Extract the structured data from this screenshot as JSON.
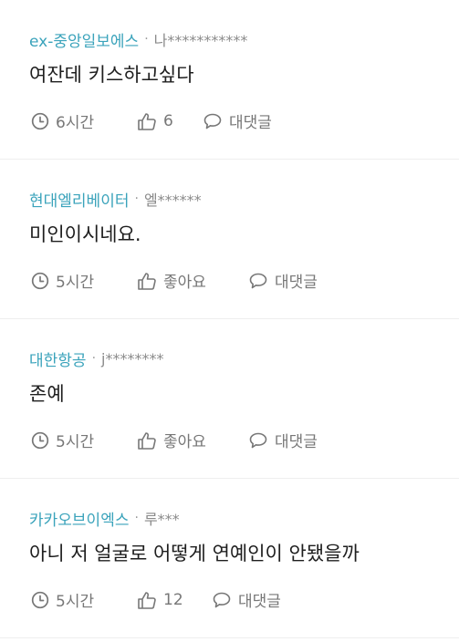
{
  "comments": [
    {
      "company": "ex-중앙일보에스",
      "separator": "·",
      "author": "나***********",
      "text": "여잔데 키스하고싶다",
      "time": "6시간",
      "likes": "6",
      "reply_label": "대댓글"
    },
    {
      "company": "현대엘리베이터",
      "separator": "·",
      "author": "엘******",
      "text": "미인이시네요.",
      "time": "5시간",
      "likes": "좋아요",
      "reply_label": "대댓글"
    },
    {
      "company": "대한항공",
      "separator": "·",
      "author": "j********",
      "text": "존예",
      "time": "5시간",
      "likes": "좋아요",
      "reply_label": "대댓글"
    },
    {
      "company": "카카오브이엑스",
      "separator": "·",
      "author": "루***",
      "text": "아니 저 얼굴로 어떻게 연예인이 안됐을까",
      "time": "5시간",
      "likes": "12",
      "reply_label": "대댓글"
    }
  ],
  "icons": {
    "time": "clock-icon",
    "like": "thumbs-up-icon",
    "reply": "speech-bubble-icon"
  },
  "colors": {
    "company": "#3aa3bb",
    "author": "#8a8a8a",
    "text": "#1e1e1e",
    "meta": "#777777",
    "divider": "#eeeeee"
  }
}
